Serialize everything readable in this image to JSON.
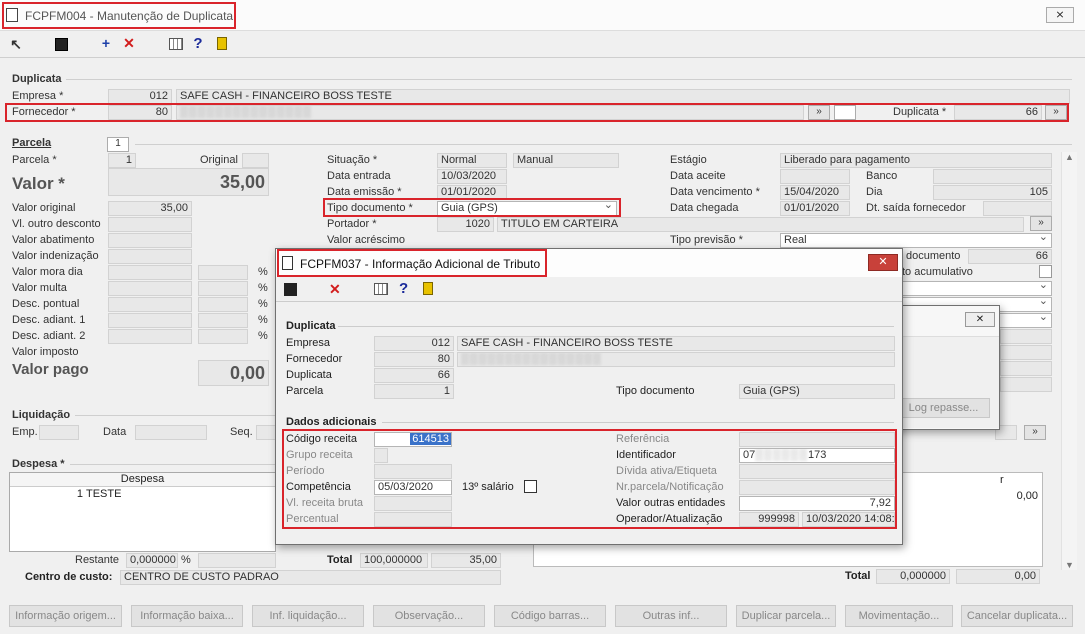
{
  "window": {
    "title": "FCPFM004 - Manutenção de Duplicata",
    "close": "⨯"
  },
  "duplicata_section": {
    "label": "Duplicata",
    "empresa_label": "Empresa *",
    "empresa_code": "012",
    "empresa_name": "SAFE CASH - FINANCEIRO BOSS TESTE",
    "fornecedor_label": "Fornecedor *",
    "fornecedor_code": "80",
    "duplicata_label": "Duplicata *",
    "duplicata_value": "66"
  },
  "parcela_section": {
    "label": "Parcela",
    "tab": "1",
    "parcela_label": "Parcela *",
    "parcela_value": "1",
    "original_label": "Original",
    "valor_label": "Valor *",
    "valor_value": "35,00",
    "valor_original_label": "Valor original",
    "valor_original": "35,00",
    "vl_outro_desconto": "Vl. outro desconto",
    "valor_abatimento": "Valor abatimento",
    "valor_indenizacao": "Valor indenização",
    "valor_mora_dia": "Valor mora dia",
    "valor_multa": "Valor multa",
    "desc_pontual": "Desc. pontual",
    "desc_adiant_1": "Desc. adiant. 1",
    "desc_adiant_2": "Desc. adiant. 2",
    "valor_imposto": "Valor imposto",
    "valor_pago_label": "Valor pago",
    "valor_pago": "0,00",
    "pct": "%",
    "situacao_label": "Situação *",
    "situacao_value": "Normal",
    "situacao_tipo": "Manual",
    "data_entrada_label": "Data entrada",
    "data_entrada": "10/03/2020",
    "data_emissao_label": "Data emissão *",
    "data_emissao": "01/01/2020",
    "tipo_documento_label": "Tipo documento *",
    "tipo_documento": "Guia (GPS)",
    "portador_label": "Portador *",
    "portador_code": "1020",
    "portador_name": "TITULO EM CARTEIRA",
    "valor_acrescimo_label": "Valor acréscimo",
    "estagio_label": "Estágio",
    "estagio": "Liberado para pagamento",
    "data_aceite_label": "Data aceite",
    "banco_label": "Banco",
    "data_vencimento_label": "Data vencimento *",
    "data_vencimento": "15/04/2020",
    "dia_label": "Dia",
    "dia_value": "105",
    "data_chegada_label": "Data chegada",
    "data_chegada": "01/01/2020",
    "dt_saida_label": "Dt. saída fornecedor",
    "tipo_previsao_label": "Tipo previsão *",
    "tipo_previsao": "Real",
    "documento_label": "documento",
    "documento_value": "66",
    "acumulativo_label": "to acumulativo"
  },
  "liquidacao": {
    "label": "Liquidação",
    "emp": "Emp.",
    "data": "Data",
    "seq": "Seq."
  },
  "despesa": {
    "label": "Despesa *",
    "col_despesa": "Despesa",
    "row_code": "1",
    "row_name": "TESTE",
    "restante_label": "Restante",
    "restante_value": "0,000000",
    "pct": "%",
    "total_label": "Total",
    "total_pct": "100,000000",
    "total_value": "35,00",
    "centro_label": "Centro de custo:",
    "centro_value": "CENTRO DE CUSTO PADRAO"
  },
  "right_table": {
    "col_r": "r",
    "row_value": "0,00",
    "total_label": "Total",
    "total_pct": "0,000000",
    "total_value": "0,00"
  },
  "bottom_buttons": [
    "Informação origem...",
    "Informação baixa...",
    "Inf. liquidação...",
    "Observação...",
    "Código barras...",
    "Outras inf...",
    "Duplicar parcela...",
    "Movimentação...",
    "Cancelar duplicata..."
  ],
  "dialog": {
    "title": "FCPFM037 - Informação Adicional de Tributo",
    "close": "✕",
    "group_duplicata": "Duplicata",
    "empresa_label": "Empresa",
    "empresa_code": "012",
    "empresa_name": "SAFE CASH - FINANCEIRO BOSS TESTE",
    "fornecedor_label": "Fornecedor",
    "fornecedor_code": "80",
    "duplicata_label": "Duplicata",
    "duplicata_value": "66",
    "parcela_label": "Parcela",
    "parcela_value": "1",
    "tipo_documento_label": "Tipo documento",
    "tipo_documento": "Guia (GPS)",
    "group_dados": "Dados adicionais",
    "codigo_receita_label": "Código receita",
    "codigo_receita": "614513",
    "grupo_receita_label": "Grupo receita",
    "periodo_label": "Período",
    "competencia_label": "Competência",
    "competencia": "05/03/2020",
    "decimo_label": "13º salário",
    "vl_receita_bruta_label": "Vl. receita bruta",
    "percentual_label": "Percentual",
    "referencia_label": "Referência",
    "identificador_label": "Identificador",
    "identificador_prefix": "07",
    "identificador_suffix": "173",
    "divida_label": "Dívida ativa/Etiqueta",
    "nr_parcela_label": "Nr.parcela/Notificação",
    "valor_outras_label": "Valor outras entidades",
    "valor_outras": "7,92",
    "operador_label": "Operador/Atualização",
    "operador_code": "999998",
    "operador_data": "10/03/2020 14:08:"
  },
  "back_dialog": {
    "close": "✕",
    "log_repasse": "Log repasse..."
  }
}
